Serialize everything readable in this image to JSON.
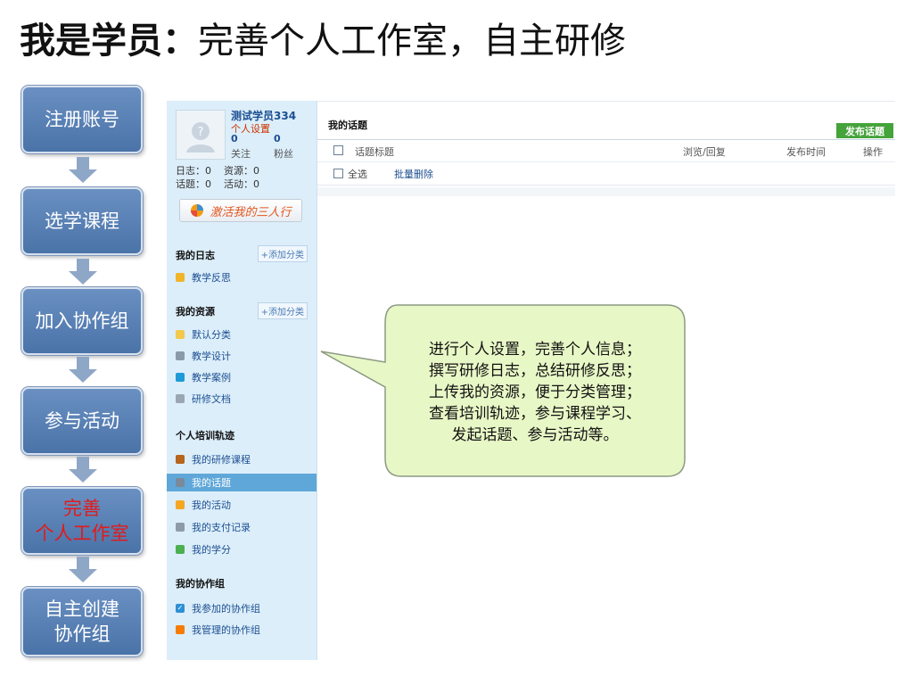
{
  "title": {
    "bold": "我是学员：",
    "normal": "完善个人工作室，自主研修"
  },
  "flow_steps": [
    {
      "label": "注册账号",
      "active": false
    },
    {
      "label": "选学课程",
      "active": false
    },
    {
      "label": "加入协作组",
      "active": false
    },
    {
      "label": "参与活动",
      "active": false
    },
    {
      "label": "完善\n个人工作室",
      "active": true
    },
    {
      "label": "自主创建\n协作组",
      "active": false
    }
  ],
  "profile": {
    "username": "测试学员334",
    "settings_link": "个人设置",
    "follow_count": "0",
    "follow_label": "关注",
    "fans_count": "0",
    "fans_label": "粉丝",
    "log_line": "日志：0    资源：0",
    "topic_line": "话题：0    活动：0",
    "activate_button": "激活我的三人行"
  },
  "sidebar": {
    "my_logs": {
      "title": "我的日志",
      "add": "+添加分类",
      "items": [
        "教学反思"
      ]
    },
    "my_resources": {
      "title": "我的资源",
      "add": "+添加分类",
      "items": [
        "默认分类",
        "教学设计",
        "教学案例",
        "研修文档"
      ]
    },
    "training": {
      "title": "个人培训轨迹",
      "items": [
        "我的研修课程",
        "我的话题",
        "我的活动",
        "我的支付记录",
        "我的学分"
      ],
      "selected": "我的话题"
    },
    "groups": {
      "title": "我的协作组",
      "items": [
        "我参加的协作组",
        "我管理的协作组"
      ]
    }
  },
  "main": {
    "title": "我的话题",
    "publish_button": "发布话题",
    "columns": [
      "话题标题",
      "浏览/回复",
      "发布时间",
      "操作"
    ],
    "select_all": "全选",
    "bulk_delete": "批量删除"
  },
  "callout": {
    "lines": [
      "进行个人设置，完善个人信息；",
      "撰写研修日志，总结研修反思；",
      "上传我的资源，便于分类管理；",
      "查看培训轨迹，参与课程学习、",
      "发起话题、参与活动等。"
    ]
  },
  "colors": {
    "step_blue": "#5a82b8",
    "step_active_text": "#e21a1a",
    "sidebar_bg": "#dceefa",
    "callout_fill": "#e8f7c6",
    "publish_green": "#45a33b"
  }
}
